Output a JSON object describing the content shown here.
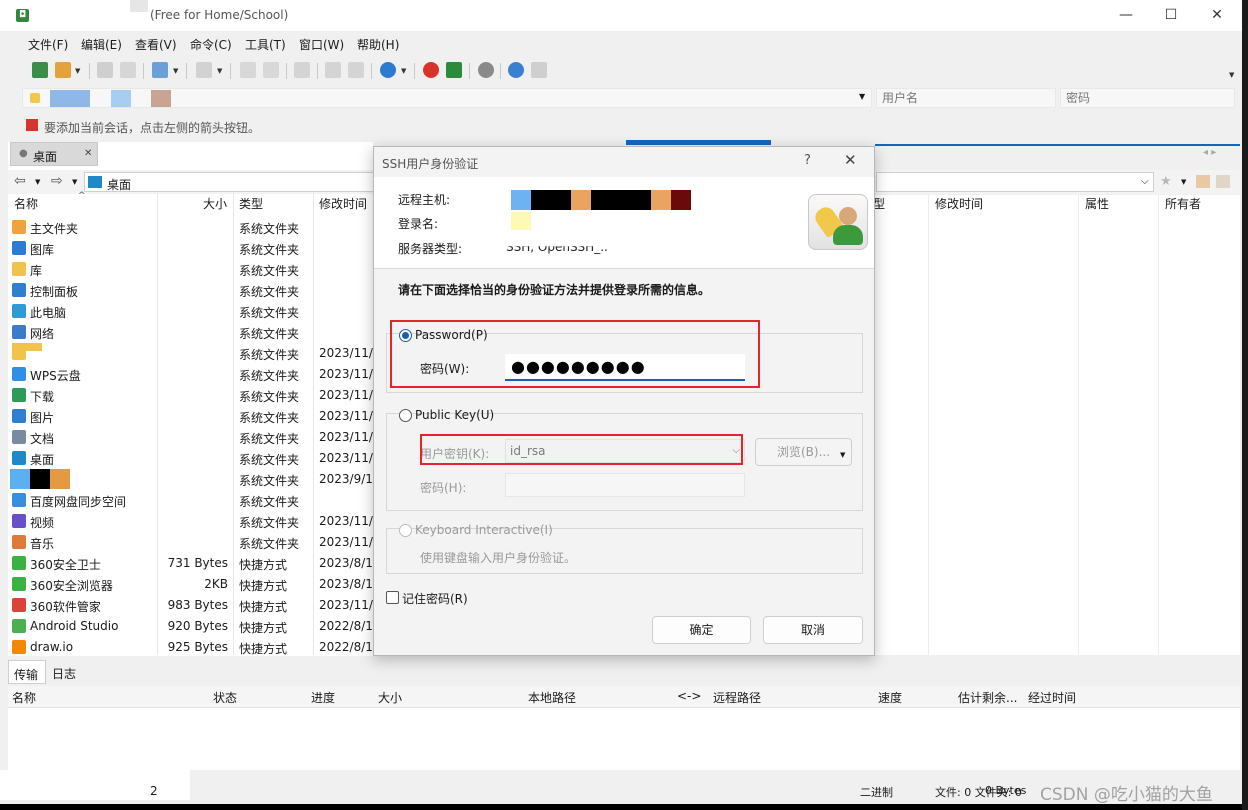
{
  "window": {
    "title": "(Free for Home/School)",
    "minimize": "—",
    "maximize": "☐",
    "close": "✕"
  },
  "menu": [
    "文件(F)",
    "编辑(E)",
    "查看(V)",
    "命令(C)",
    "工具(T)",
    "窗口(W)",
    "帮助(H)"
  ],
  "address": {
    "user_placeholder": "用户名",
    "password_placeholder": "密码"
  },
  "hint": "要添加当前会话，点击左侧的箭头按钮。",
  "left_tab": "桌面",
  "path": "桌面",
  "left_columns": [
    "名称",
    "大小",
    "类型",
    "修改时间"
  ],
  "right_columns": [
    "修改时间",
    "属性",
    "所有者"
  ],
  "right_col_partial": "型",
  "files": [
    {
      "name": "主文件夹",
      "size": "",
      "type": "系统文件夹",
      "date": "",
      "color": "#f0a23c"
    },
    {
      "name": "图库",
      "size": "",
      "type": "系统文件夹",
      "date": "",
      "color": "#2b7bd6"
    },
    {
      "name": "库",
      "size": "",
      "type": "系统文件夹",
      "date": "",
      "color": "#f2c34a"
    },
    {
      "name": "控制面板",
      "size": "",
      "type": "系统文件夹",
      "date": "",
      "color": "#2f7fd1"
    },
    {
      "name": "此电脑",
      "size": "",
      "type": "系统文件夹",
      "date": "",
      "color": "#2f9ad6"
    },
    {
      "name": "网络",
      "size": "",
      "type": "系统文件夹",
      "date": "",
      "color": "#3a7cc8"
    },
    {
      "name": "",
      "size": "",
      "type": "系统文件夹",
      "date": "2023/11/",
      "color": "#f2c34a"
    },
    {
      "name": "WPS云盘",
      "size": "",
      "type": "系统文件夹",
      "date": "2023/11/",
      "color": "#2f8ee6"
    },
    {
      "name": "下载",
      "size": "",
      "type": "系统文件夹",
      "date": "2023/11/",
      "color": "#2e9a5a"
    },
    {
      "name": "图片",
      "size": "",
      "type": "系统文件夹",
      "date": "2023/11/",
      "color": "#2f7fd1"
    },
    {
      "name": "文档",
      "size": "",
      "type": "系统文件夹",
      "date": "2023/11/",
      "color": "#7a8aa0"
    },
    {
      "name": "桌面",
      "size": "",
      "type": "系统文件夹",
      "date": "2023/11/",
      "color": "#1e88c8"
    },
    {
      "name": "",
      "size": "",
      "type": "系统文件夹",
      "date": "2023/9/1",
      "color": "#f2c34a"
    },
    {
      "name": "百度网盘同步空间",
      "size": "",
      "type": "系统文件夹",
      "date": "",
      "color": "#3a8ee0"
    },
    {
      "name": "视频",
      "size": "",
      "type": "系统文件夹",
      "date": "2023/11/",
      "color": "#6a4fc8"
    },
    {
      "name": "音乐",
      "size": "",
      "type": "系统文件夹",
      "date": "2023/11/",
      "color": "#e07a3a"
    },
    {
      "name": "360安全卫士",
      "size": "731 Bytes",
      "type": "快捷方式",
      "date": "2023/8/1",
      "color": "#3cb043"
    },
    {
      "name": "360安全浏览器",
      "size": "2KB",
      "type": "快捷方式",
      "date": "2023/8/1",
      "color": "#3cb043"
    },
    {
      "name": "360软件管家",
      "size": "983 Bytes",
      "type": "快捷方式",
      "date": "2023/11/",
      "color": "#d9433a"
    },
    {
      "name": "Android Studio",
      "size": "920 Bytes",
      "type": "快捷方式",
      "date": "2022/8/1",
      "color": "#4caf50"
    },
    {
      "name": "draw.io",
      "size": "925 Bytes",
      "type": "快捷方式",
      "date": "2022/8/1",
      "color": "#f08705"
    }
  ],
  "transfer": {
    "tabs": [
      "传输",
      "日志"
    ],
    "columns": [
      "名称",
      "状态",
      "进度",
      "大小",
      "本地路径",
      "<->",
      "远程路径",
      "速度",
      "估计剩余...",
      "经过时间"
    ]
  },
  "status": {
    "left": "2",
    "mode": "二进制",
    "files": "文件: 0  文件夹: 0",
    "bytes": "0 Bytes",
    "watermark": "CSDN @吃小猫的大鱼"
  },
  "dialog": {
    "title": "SSH用户身份验证",
    "help": "?",
    "close": "✕",
    "host_label": "远程主机:",
    "login_label": "登录名:",
    "server_label": "服务器类型:",
    "server_value": "SSH, OpenSSH_..",
    "instruction": "请在下面选择恰当的身份验证方法并提供登录所需的信息。",
    "password_option": "Password(P)",
    "password_field_label": "密码(W):",
    "password_value": "●●●●●●●●●",
    "publickey_option": "Public Key(U)",
    "userkey_label": "用户密钥(K):",
    "userkey_value": "id_rsa",
    "browse_label": "浏览(B)...",
    "keypw_label": "密码(H):",
    "keyboard_option": "Keyboard Interactive(I)",
    "keyboard_desc": "使用键盘输入用户身份验证。",
    "remember_label": "记住密码(R)",
    "ok_label": "确定",
    "cancel_label": "取消",
    "selected_method": "password"
  },
  "colors": {
    "accent": "#1a5fb4",
    "highlight_box": "#e4262c"
  }
}
